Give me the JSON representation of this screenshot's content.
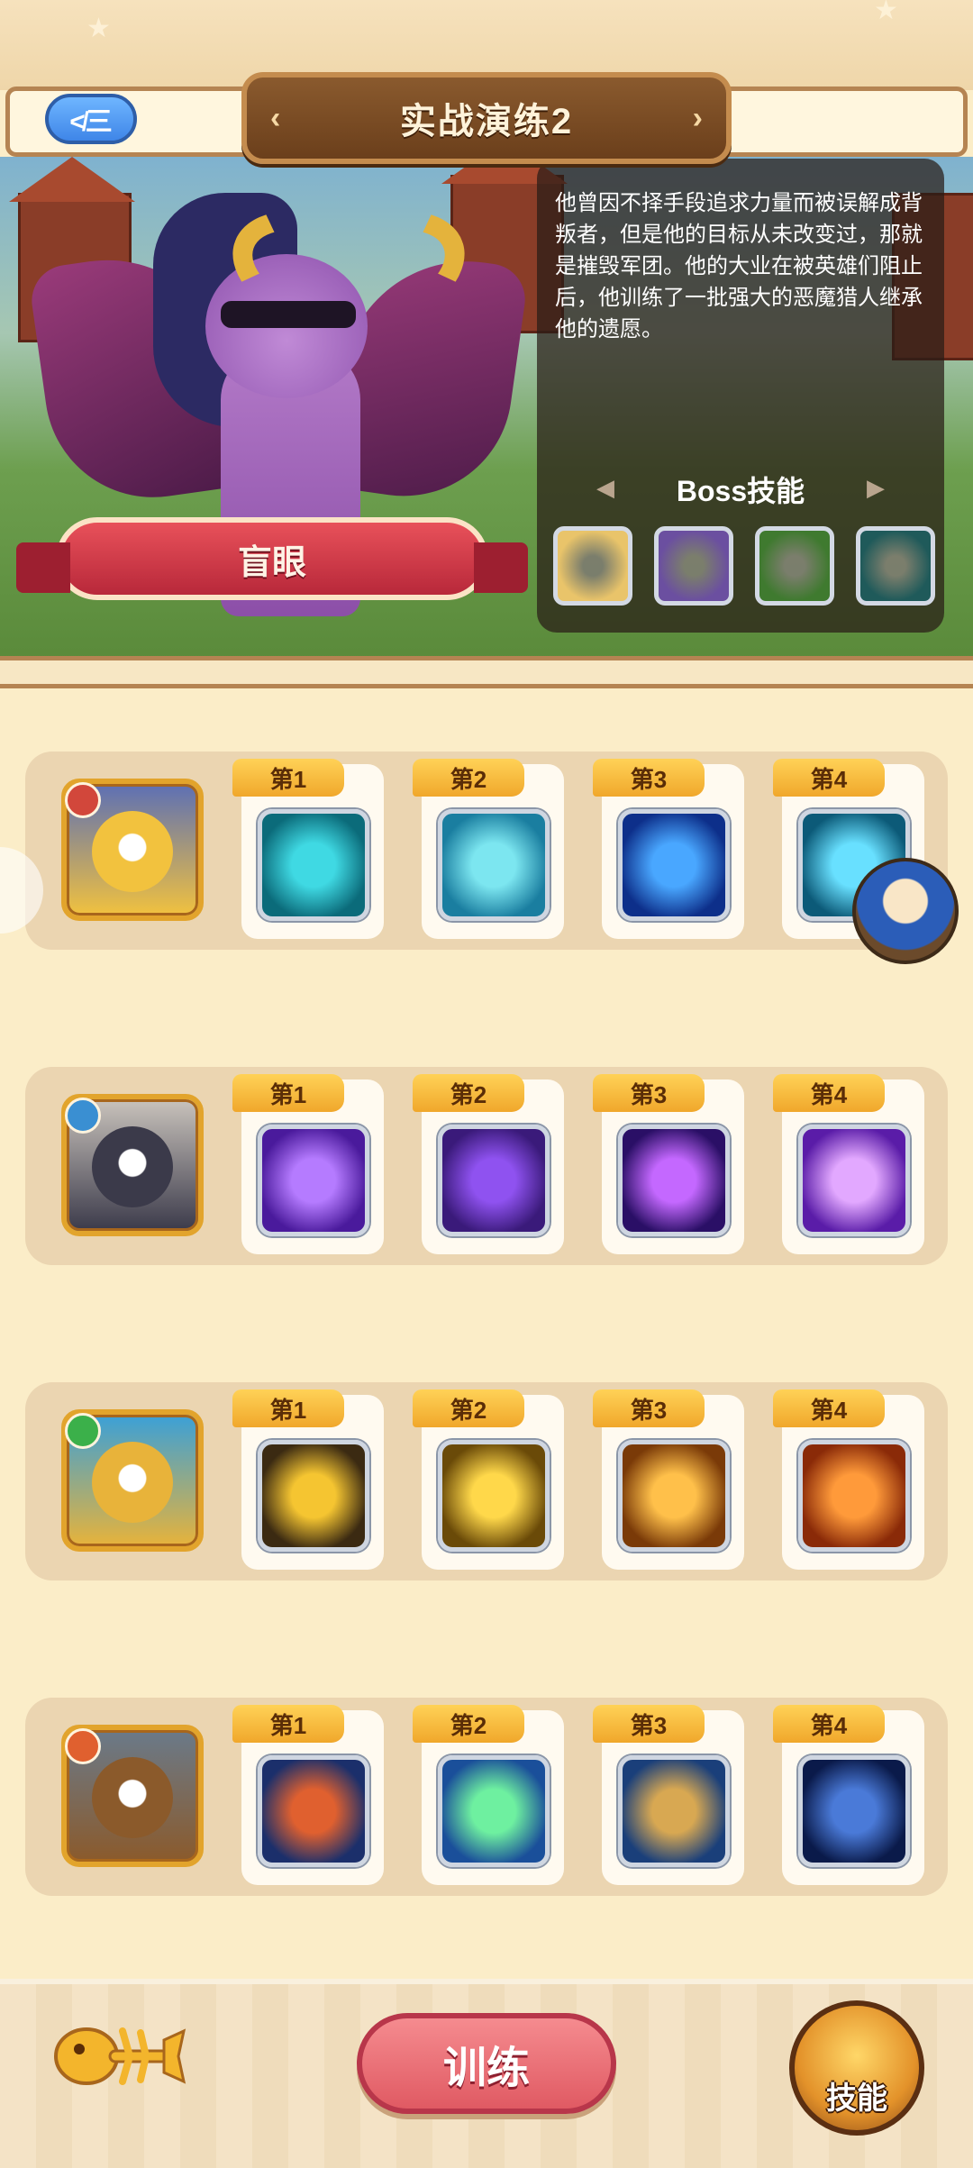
{
  "header": {
    "title": "实战演练2",
    "back_icon_text": "≮三"
  },
  "boss": {
    "name": "盲眼",
    "lore": "他曾因不择手段追求力量而被误解成背叛者，但是他的目标从未改变过，那就是摧毁军团。他的大业在被英雄们阻止后，他训练了一批强大的恶魔猎人继承他的遗愿。",
    "skills_label": "Boss技能",
    "skill_colors": [
      "#e9c46a",
      "#6b4fa0",
      "#3f7a2f",
      "#1f5a5a"
    ]
  },
  "rows": [
    {
      "hero_colors": [
        "#5c6fb5",
        "#f2c23e"
      ],
      "badge_color": "#d2473b",
      "slots": [
        {
          "label": "第1",
          "colors": [
            "#0b6b7a",
            "#3fd9e3"
          ]
        },
        {
          "label": "第2",
          "colors": [
            "#1a7ea0",
            "#7ce6f0"
          ]
        },
        {
          "label": "第3",
          "colors": [
            "#0d2f8a",
            "#49a7ff"
          ]
        },
        {
          "label": "第4",
          "colors": [
            "#0c5a78",
            "#68e0ff"
          ]
        }
      ]
    },
    {
      "hero_colors": [
        "#c9c3bc",
        "#3b3a4a"
      ],
      "badge_color": "#3a8fd2",
      "slots": [
        {
          "label": "第1",
          "colors": [
            "#4a1a9c",
            "#b57bff"
          ]
        },
        {
          "label": "第2",
          "colors": [
            "#3a1a7a",
            "#8f52f0"
          ]
        },
        {
          "label": "第3",
          "colors": [
            "#2a0f66",
            "#c468ff"
          ]
        },
        {
          "label": "第4",
          "colors": [
            "#5a1ca8",
            "#e2a8ff"
          ]
        }
      ]
    },
    {
      "hero_colors": [
        "#3aa0d8",
        "#e8b33a"
      ],
      "badge_color": "#3bb04a",
      "slots": [
        {
          "label": "第1",
          "colors": [
            "#3b2a12",
            "#f5c531"
          ]
        },
        {
          "label": "第2",
          "colors": [
            "#6a4a08",
            "#ffd84a"
          ]
        },
        {
          "label": "第3",
          "colors": [
            "#7a3a08",
            "#ffc04a"
          ]
        },
        {
          "label": "第4",
          "colors": [
            "#8a2a08",
            "#ff9a3a"
          ]
        }
      ]
    },
    {
      "hero_colors": [
        "#6a7a8a",
        "#8b5a2b"
      ],
      "badge_color": "#e0602f",
      "slots": [
        {
          "label": "第1",
          "colors": [
            "#1b2f6b",
            "#e0602f"
          ]
        },
        {
          "label": "第2",
          "colors": [
            "#1a4f9a",
            "#6ef0a0"
          ]
        },
        {
          "label": "第3",
          "colors": [
            "#1a3f7a",
            "#d8a852"
          ]
        },
        {
          "label": "第4",
          "colors": [
            "#0a1a4a",
            "#4a7ad8"
          ]
        }
      ]
    }
  ],
  "footer": {
    "train_label": "训练",
    "skill_label": "技能"
  }
}
